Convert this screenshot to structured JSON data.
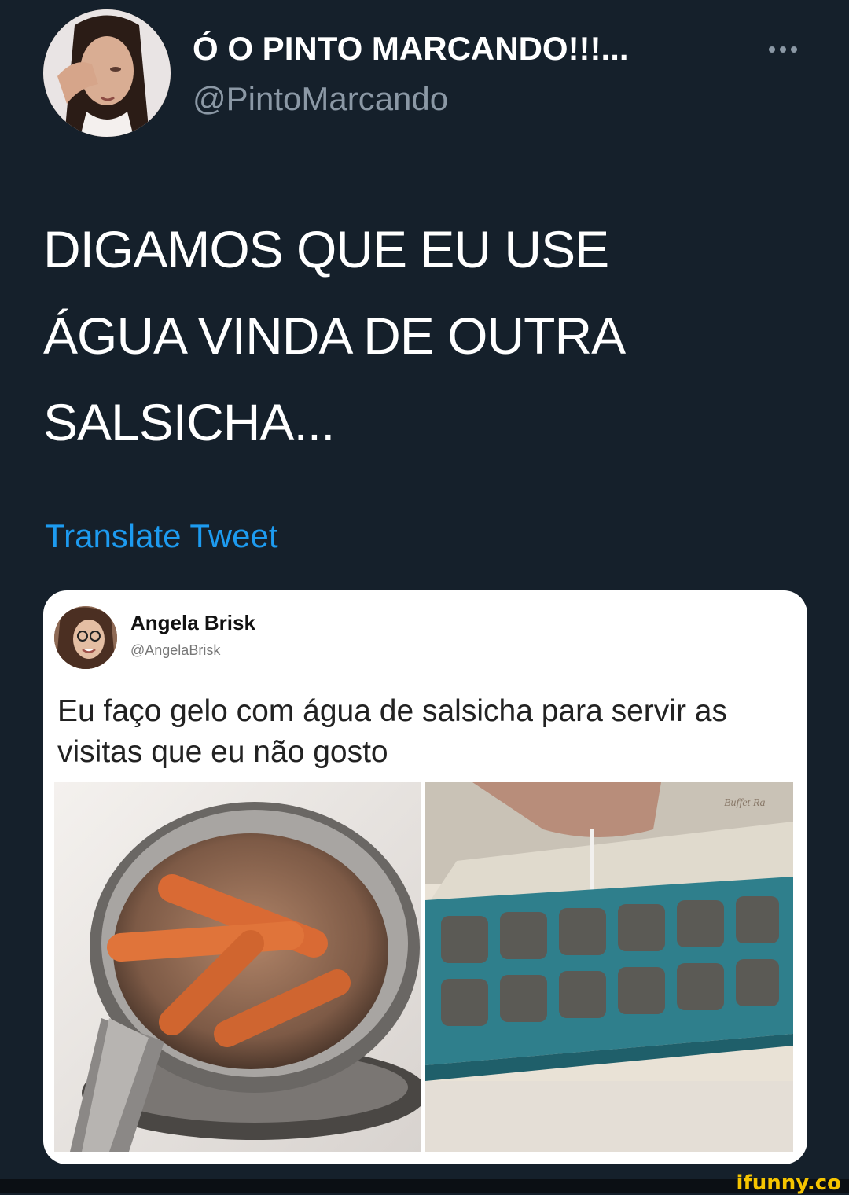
{
  "author": {
    "display_name": "Ó O PINTO MARCANDO!!!...",
    "handle": "@PintoMarcando"
  },
  "tweet": {
    "text": "DIGAMOS QUE EU USE\nÁGUA VINDA DE OUTRA\nSALSICHA...",
    "translate_label": "Translate Tweet"
  },
  "quoted": {
    "display_name": "Angela Brisk",
    "handle": "@AngelaBrisk",
    "text": "Eu faço gelo com água de salsicha para servir as visitas que eu não gosto",
    "tray_label": "Buffet Ra"
  },
  "watermark": "ifunny.co",
  "icons": {
    "more": "more-dots-icon"
  },
  "colors": {
    "background": "#15202b",
    "link": "#1d9bf0",
    "secondary_text": "#8b98a5"
  }
}
